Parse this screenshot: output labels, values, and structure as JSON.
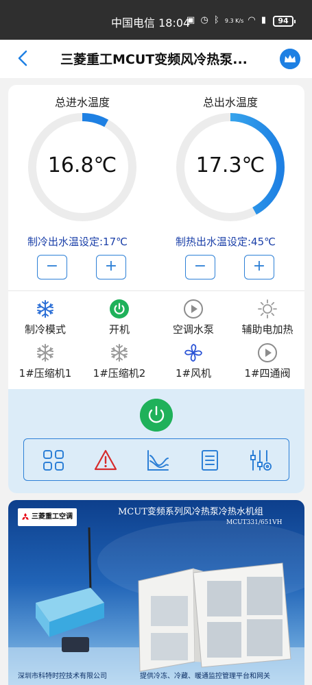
{
  "status_bar": {
    "carrier_time": "中国电信 18:04",
    "network_speed": "9.3 K/s",
    "battery": "94"
  },
  "nav": {
    "title": "三菱重工MCUT变频风冷热泵..."
  },
  "gauges": {
    "inlet": {
      "title": "总进水温度",
      "value": "16.8℃",
      "level": 0.08
    },
    "outlet": {
      "title": "总出水温度",
      "value": "17.3℃",
      "level": 0.42
    }
  },
  "setpoints": {
    "cooling": {
      "label": "制冷出水温设定:17℃",
      "minus": "−",
      "plus": "+"
    },
    "heating": {
      "label": "制热出水温设定:45℃",
      "minus": "−",
      "plus": "+"
    }
  },
  "statuses": [
    {
      "label": "制冷模式",
      "icon": "snowflake-icon",
      "color": "#2c6fd6"
    },
    {
      "label": "开机",
      "icon": "power-icon",
      "color": "#1fb15a"
    },
    {
      "label": "空调水泵",
      "icon": "play-circle-icon",
      "color": "#8c8c8c"
    },
    {
      "label": "辅助电加热",
      "icon": "sun-icon",
      "color": "#9a9a9a"
    },
    {
      "label": "1#压缩机1",
      "icon": "snowflake-icon",
      "color": "#9a9a9a"
    },
    {
      "label": "1#压缩机2",
      "icon": "snowflake-icon",
      "color": "#9a9a9a"
    },
    {
      "label": "1#风机",
      "icon": "fan-icon",
      "color": "#2c55d6"
    },
    {
      "label": "1#四通阀",
      "icon": "play-circle-icon",
      "color": "#8c8c8c"
    }
  ],
  "toolbar": {
    "tools": [
      "grid-icon",
      "alarm-icon",
      "chart-icon",
      "list-icon",
      "settings-slider-icon"
    ]
  },
  "banner": {
    "brand": "三菱重工空调",
    "title": "MCUT变频系列风冷热泵冷热水机组",
    "model": "MCUT331/651VH",
    "company": "深圳市科特时控技术有限公司",
    "slogan": "提供冷冻、冷藏、暖通监控管理平台和网关"
  },
  "colors": {
    "accent": "#2c7fd6",
    "setpoint_text": "#1a3fa8",
    "power_green": "#1fb15a",
    "panel_bg": "#dcecf8"
  }
}
